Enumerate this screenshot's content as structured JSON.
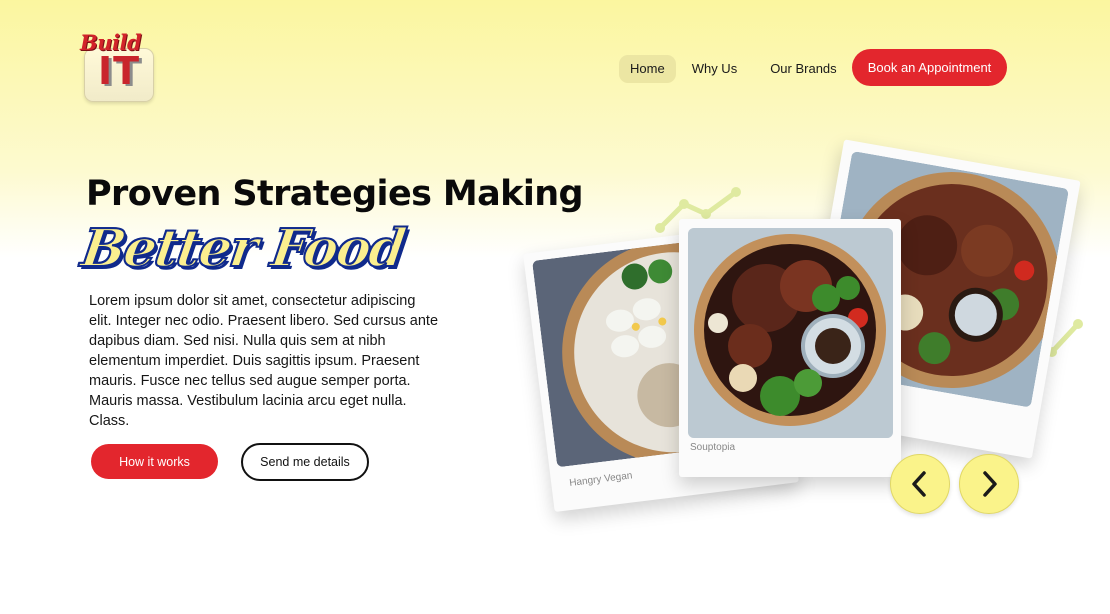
{
  "brand": {
    "script_text": "Build",
    "main_text": "IT"
  },
  "nav": {
    "items": [
      {
        "label": "Home",
        "active": true
      },
      {
        "label": "Why Us",
        "active": false
      },
      {
        "label": "Our Brands",
        "active": false
      }
    ],
    "cta_label": "Book an Appointment"
  },
  "hero": {
    "title": "Proven Strategies Making",
    "script_title": "Better Food",
    "body": "Lorem ipsum dolor sit amet, consectetur adipiscing elit. Integer nec odio. Praesent libero. Sed cursus ante dapibus diam. Sed nisi. Nulla quis sem at nibh elementum imperdiet. Duis sagittis ipsum. Praesent mauris. Fusce nec tellus sed augue semper porta. Mauris massa. Vestibulum lacinia arcu eget nulla. Class.",
    "primary_button": "How it works",
    "secondary_button": "Send me details"
  },
  "carousel": {
    "cards": [
      {
        "caption": "Hangry Vegan",
        "position": "left"
      },
      {
        "caption": "Souptopia",
        "position": "center"
      },
      {
        "caption": "",
        "position": "right"
      }
    ],
    "prev_icon": "chevron-left-icon",
    "next_icon": "chevron-right-icon"
  },
  "colors": {
    "accent_red": "#e3262d",
    "accent_yellow": "#faf38a",
    "script_blue": "#102a8c",
    "deco_green": "#dfeaa0"
  }
}
